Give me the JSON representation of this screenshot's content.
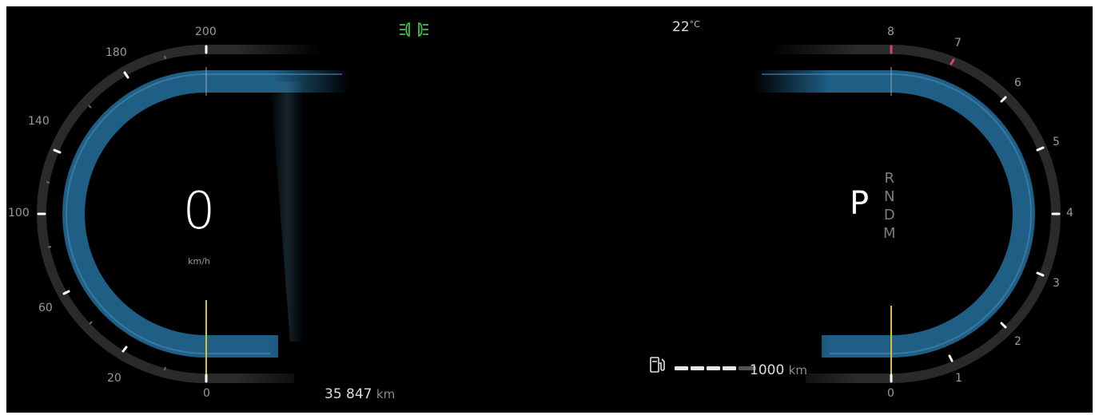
{
  "speedometer": {
    "speed": "0",
    "unit": "km/h",
    "scale_labels": [
      "200",
      "180",
      "140",
      "100",
      "60",
      "20",
      "0"
    ]
  },
  "tachometer": {
    "scale_labels": [
      "8",
      "7",
      "6",
      "5",
      "4",
      "3",
      "2",
      "1",
      "0"
    ]
  },
  "gear": {
    "current": "P",
    "options": [
      "R",
      "N",
      "D",
      "M"
    ]
  },
  "odometer": {
    "value": "35 847",
    "unit": "km"
  },
  "range": {
    "value": "1000",
    "unit": "km",
    "fuel_level_fraction": 0.8
  },
  "temperature": {
    "value": "22",
    "unit": "°C"
  },
  "indicators": {
    "headlights_icon": "low-beam-headlight-icon",
    "headlights_color": "#3bbf4a"
  },
  "icons": {
    "fuel": "fuel-pump-icon"
  },
  "colors": {
    "background": "#000000",
    "arc_fill": "#1e5f86",
    "needle": "#d8c23a",
    "redline": "#d8465a"
  }
}
